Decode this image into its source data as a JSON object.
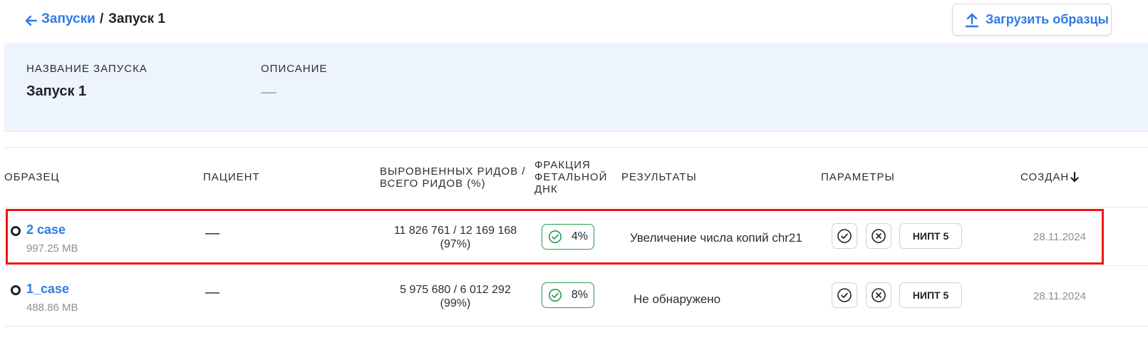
{
  "header": {
    "breadcrumb_parent": "Запуски",
    "breadcrumb_separator": "/",
    "breadcrumb_current": "Запуск 1",
    "upload_button_label": "Загрузить образцы"
  },
  "info": {
    "name_label": "НАЗВАНИЕ ЗАПУСКА",
    "name_value": "Запуск 1",
    "description_label": "ОПИСАНИЕ",
    "description_value": "—"
  },
  "table": {
    "headers": {
      "sample": "ОБРАЗЕЦ",
      "patient": "ПАЦИЕНТ",
      "reads_line1": "ВЫРОВНЕННЫХ РИДОВ /",
      "reads_line2": "ВСЕГО РИДОВ (%)",
      "ff_line1": "ФРАКЦИЯ",
      "ff_line2": "ФЕТАЛЬНОЙ",
      "ff_line3": "ДНК",
      "results": "РЕЗУЛЬТАТЫ",
      "params": "ПАРАМЕТРЫ",
      "created": "СОЗДАН",
      "sort_icon": "arrow-down-icon"
    },
    "rows": [
      {
        "sample": "2 case",
        "size": "997.25 MB",
        "patient": "—",
        "reads_line1": "11 826 761 / 12 169 168",
        "reads_line2": "(97%)",
        "fetal_fraction": "4%",
        "result": "Увеличение числа копий chr21",
        "param_label": "НИПТ 5",
        "created": "28.11.2024",
        "highlighted": true
      },
      {
        "sample": "1_case",
        "size": "488.86 MB",
        "patient": "—",
        "reads_line1": "5 975 680 / 6 012 292",
        "reads_line2": "(99%)",
        "fetal_fraction": "8%",
        "result": "Не обнаружено",
        "param_label": "НИПТ 5",
        "created": "28.11.2024",
        "highlighted": false
      }
    ]
  },
  "colors": {
    "accent": "#2f7ae5",
    "panel_bg": "#edf4fe",
    "success": "#2a9a4e",
    "highlight": "#f01414"
  }
}
